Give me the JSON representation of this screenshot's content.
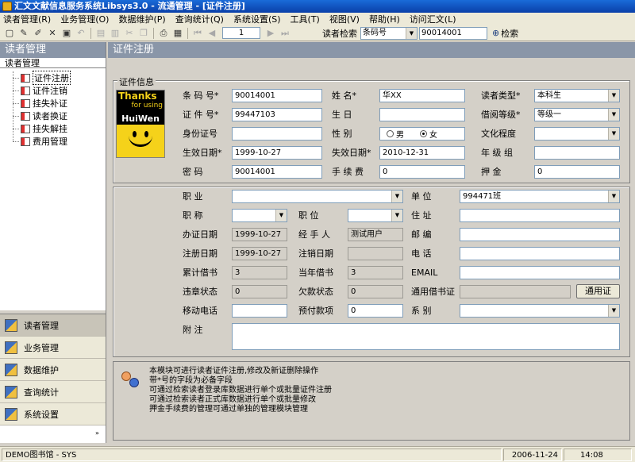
{
  "window": {
    "title": "汇文文献信息服务系统Libsys3.0 - 流通管理 - [证件注册]"
  },
  "menu": [
    "读者管理(R)",
    "业务管理(O)",
    "数据维护(P)",
    "查询统计(Q)",
    "系统设置(S)",
    "工具(T)",
    "视图(V)",
    "帮助(H)",
    "访问汇文(L)"
  ],
  "toolbar": {
    "page_value": "1",
    "search_label": "读者检索",
    "search_type": "条码号",
    "search_value": "90014001",
    "search_button": "检索"
  },
  "left_panel": {
    "title": "读者管理",
    "subtitle": "读者管理",
    "tree": [
      "证件注册",
      "证件注销",
      "挂失补证",
      "读者换证",
      "挂失解挂",
      "费用管理"
    ],
    "selected": 0,
    "nav": [
      "读者管理",
      "业务管理",
      "数据维护",
      "查询统计",
      "系统设置"
    ],
    "nav_active": 0
  },
  "content": {
    "title": "证件注册",
    "legend": "证件信息",
    "photo": {
      "line1": "Thanks",
      "line2": "for using",
      "line3": "HuiWen"
    },
    "fields": {
      "barcode_label": "条 码 号*",
      "barcode": "90014001",
      "name_label": "姓    名*",
      "name": "华XX",
      "reader_type_label": "读者类型*",
      "reader_type": "本科生",
      "card_no_label": "证 件 号*",
      "card_no": "99447103",
      "birthday_label": "生    日",
      "birthday": "",
      "borrow_level_label": "借阅等级*",
      "borrow_level": "等级一",
      "id_card_label": "身份证号",
      "id_card": "",
      "gender_label": "性    别",
      "gender_male": "男",
      "gender_female": "女",
      "education_label": "文化程度",
      "education": "",
      "valid_date_label": "生效日期*",
      "valid_date": "1999-10-27",
      "expire_date_label": "失效日期*",
      "expire_date": "2010-12-31",
      "grade_label": "年 级 组",
      "grade": "",
      "password_label": "密    码",
      "password": "90014001",
      "fee_label": "手 续 费",
      "fee": "0",
      "deposit_label": "押    金",
      "deposit": "0",
      "occupation_label": "职    业",
      "occupation": "",
      "unit_label": "单    位",
      "unit": "994471班",
      "title_label": "职    称",
      "title_val": "",
      "position_label": "职    位",
      "position": "",
      "address_label": "住    址",
      "address": "",
      "reg_date_label": "办证日期",
      "reg_date": "1999-10-27",
      "handler_label": "经 手 人",
      "handler": "测试用户",
      "postcode_label": "邮    编",
      "postcode": "",
      "register_date_label": "注册日期",
      "register_date": "1999-10-27",
      "cancel_date_label": "注销日期",
      "cancel_date": "",
      "phone_label": "电    话",
      "phone": "",
      "total_borrow_label": "累计借书",
      "total_borrow": "3",
      "current_borrow_label": "当年借书",
      "current_borrow": "3",
      "email_label": "EMAIL",
      "email": "",
      "violation_label": "违章状态",
      "violation": "0",
      "debt_label": "欠款状态",
      "debt": "0",
      "universal_label": "通用借书证",
      "universal": "",
      "universal_button": "通用证",
      "mobile_label": "移动电话",
      "mobile": "",
      "prepaid_label": "预付款项",
      "prepaid": "0",
      "category_label": "系    别",
      "category": "",
      "note_label": "附    注",
      "note": ""
    },
    "info_lines": [
      "本模块可进行读者证件注册,修改及新证删除操作",
      "带*号的字段为必备字段",
      "可通过检索读者登录库数据进行单个或批量证件注册",
      "可通过检索读者正式库数据进行单个或批量修改",
      "押金手续费的管理可通过单独的管理模块管理"
    ]
  },
  "status": {
    "library": "DEMO图书馆 - SYS",
    "date": "2006-11-24",
    "time": "14:08"
  }
}
